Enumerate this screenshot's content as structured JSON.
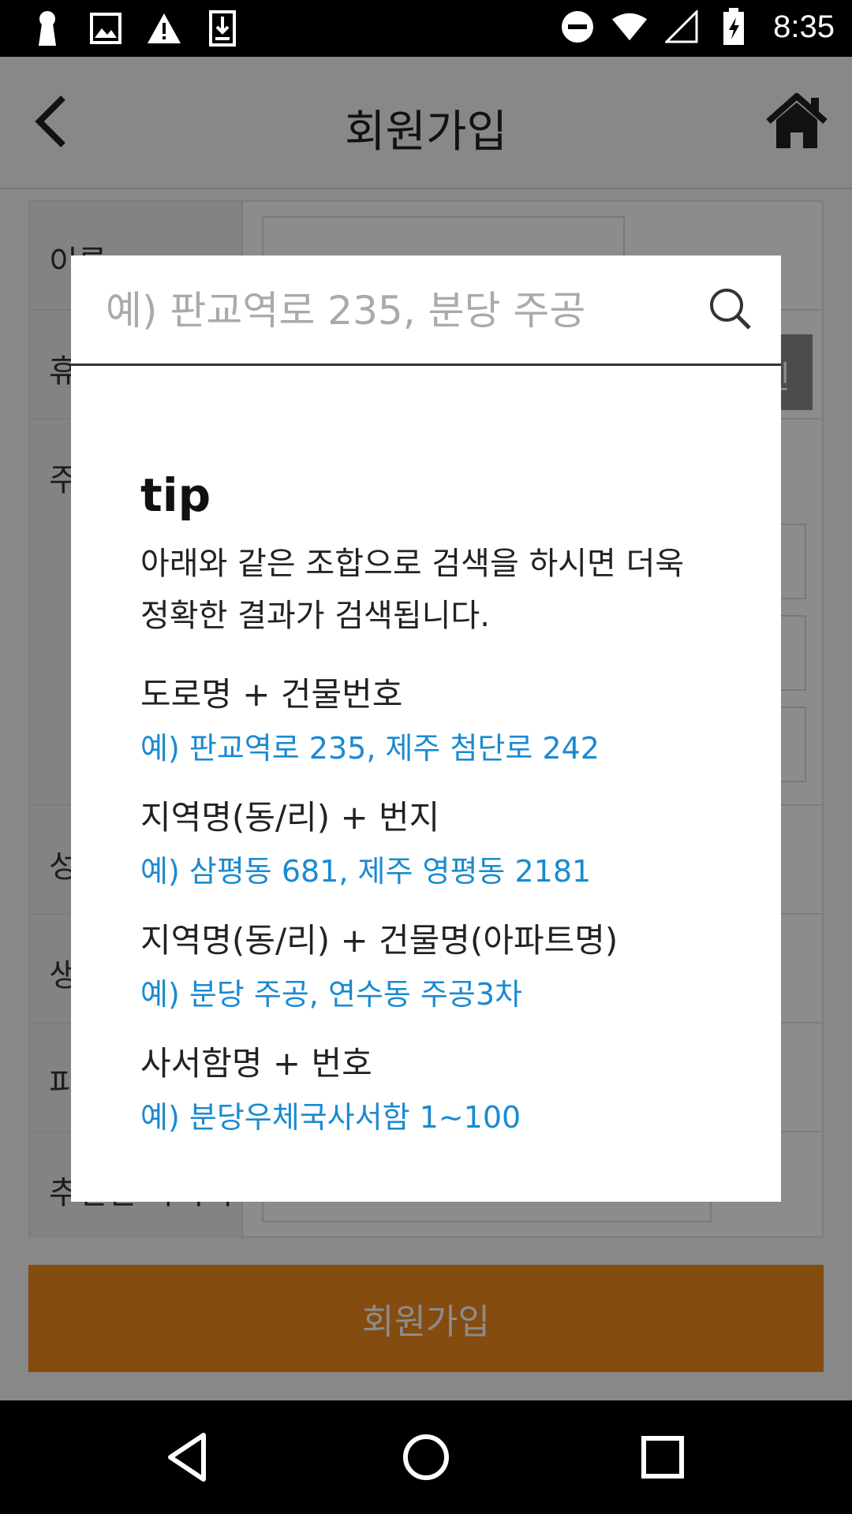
{
  "status_bar": {
    "time": "8:35",
    "left_icons": [
      "keyhole-icon",
      "image-icon",
      "warning-icon",
      "download-icon"
    ],
    "right_icons": [
      "do-not-disturb-icon",
      "wifi-icon",
      "signal-icon",
      "battery-charging-icon"
    ]
  },
  "page": {
    "title": "회원가입",
    "form_labels": [
      "이름",
      "휴",
      "주",
      "성",
      "생",
      "피",
      "추천인 아이디"
    ],
    "verify_label": "인",
    "submit_label": "회원가입"
  },
  "dialog": {
    "search_placeholder": "예) 판교역로 235, 분당 주공",
    "tip_title": "tip",
    "tip_desc_line1": "아래와 같은 조합으로 검색을 하시면 더욱",
    "tip_desc_line2": "정확한 결과가 검색됩니다.",
    "items": [
      {
        "head": "도로명 + 건물번호",
        "example": "예) 판교역로 235,  제주 첨단로 242"
      },
      {
        "head": "지역명(동/리) + 번지",
        "example": "예) 삼평동 681,  제주 영평동 2181"
      },
      {
        "head": "지역명(동/리) + 건물명(아파트명)",
        "example": "예) 분당 주공,  연수동 주공3차"
      },
      {
        "head": "사서함명 + 번호",
        "example": "예) 분당우체국사서함 1~100"
      }
    ]
  },
  "colors": {
    "accent_orange": "#f08a1c",
    "example_blue": "#1a8ad0",
    "overlay": "rgba(0,0,0,0.45)"
  }
}
